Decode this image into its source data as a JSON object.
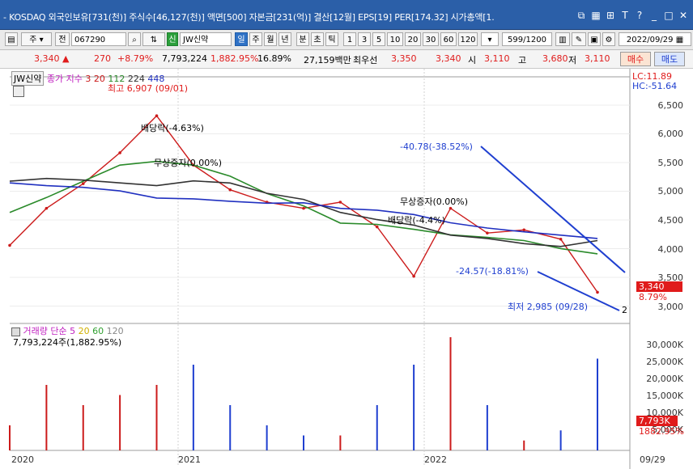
{
  "titlebar": {
    "title": "- KOSDAQ 외국인보유[731(천)] 주식수[46,127(천)] 액면[500] 자본금[231(억)] 결산[12월] EPS[19] PER[174.32] 시가총액[1.",
    "icons": [
      "restore-window-icon",
      "tile-icon",
      "dock-icon",
      "font-icon",
      "help-icon",
      "minimize-icon",
      "maximize-icon",
      "close-icon"
    ]
  },
  "toolbar": {
    "type_label": "주",
    "market_label": "전",
    "code_value": "067290",
    "credit_label": "신",
    "name_value": "JW신약",
    "periods": [
      "일",
      "주",
      "월",
      "년",
      "분",
      "초",
      "틱"
    ],
    "active_period": "일",
    "intervals": [
      "1",
      "3",
      "5",
      "10",
      "20",
      "30",
      "60",
      "120"
    ],
    "count_value": "599",
    "count_total": "1200",
    "date_value": "2022/09/29"
  },
  "quote": {
    "price": "3,340",
    "change": "270",
    "change_pct": "+8.79%",
    "volume": "7,793,224",
    "volume_pct": "1,882.95%",
    "turnover_pct": "16.89%",
    "amount": "27,159백만",
    "best_label": "최우선",
    "best_ask": "3,350",
    "best_bid": "3,340",
    "open_label": "시",
    "open": "3,110",
    "high_label": "고",
    "high": "3,680",
    "low_label": "저",
    "low": "3,110",
    "buy_label": "매수",
    "sell_label": "매도",
    "colors": {
      "up": "#e01b1b",
      "down": "#1f3fd0"
    }
  },
  "price_panel": {
    "name_tag": "JW신약",
    "legend_prefix": "종가 지수",
    "legend_items": [
      {
        "label": "3",
        "color": "#cc1b1b"
      },
      {
        "label": "20",
        "color": "#cc1b1b"
      },
      {
        "label": "112",
        "color": "#2a8a2a"
      },
      {
        "label": "224",
        "color": "#333333"
      },
      {
        "label": "448",
        "color": "#2030c0"
      }
    ],
    "lc": "LC:11.89",
    "hc": "HC:-51.64",
    "axis_ticks": [
      "6,500",
      "6,000",
      "5,500",
      "5,000",
      "4,500",
      "4,000",
      "3,500",
      "3,000"
    ],
    "last_price_badge": "3,340",
    "last_pct_badge": "8.79%",
    "annotations": {
      "high_marker": "최고 6,907 (09/01)",
      "dividend_1": "배당락(-4.63%)",
      "bonus_1": "무상증자(0.00%)",
      "drop_label": "-40.78(-38.52%)",
      "bonus_2": "무상증자(0.00%)",
      "dividend_2": "배당락(-4.4%)",
      "drop_label_2": "-24.57(-18.81%)",
      "low_marker": "최저 2,985 (09/28)",
      "trend_tag": "2"
    }
  },
  "volume_panel": {
    "legend_prefix": "거래량 단순",
    "legend_items": [
      {
        "label": "5",
        "color": "#c020c0"
      },
      {
        "label": "20",
        "color": "#d0b000"
      },
      {
        "label": "60",
        "color": "#30a030"
      },
      {
        "label": "120",
        "color": "#888888"
      }
    ],
    "summary": "7,793,224주(1,882.95%)",
    "axis_ticks": [
      "30,000K",
      "25,000K",
      "20,000K",
      "15,000K",
      "10,000K",
      "5,000K"
    ],
    "last_volume_badge": "7,793K",
    "last_volume_pct": "1882.95%"
  },
  "x_axis": {
    "labels": [
      "2020",
      "2021",
      "2022",
      "09/29"
    ]
  },
  "chart_data": {
    "type": "line",
    "title": "JW신약",
    "x": [
      "2020-01",
      "2020-03",
      "2020-05",
      "2020-07",
      "2020-09",
      "2020-11",
      "2021-01",
      "2021-03",
      "2021-05",
      "2021-07",
      "2021-09",
      "2021-11",
      "2022-01",
      "2022-03",
      "2022-05",
      "2022-07",
      "2022-09"
    ],
    "series": [
      {
        "name": "종가",
        "values": [
          4100,
          4700,
          5100,
          5600,
          6200,
          5400,
          5000,
          4800,
          4700,
          4800,
          4400,
          3600,
          4700,
          4300,
          4350,
          4200,
          3340
        ]
      }
    ],
    "ylim": [
      2900,
      6700
    ]
  }
}
